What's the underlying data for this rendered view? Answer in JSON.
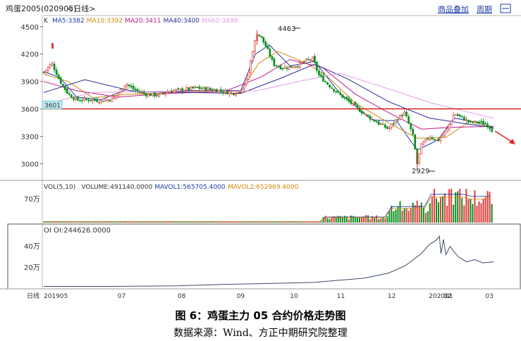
{
  "header": {
    "title": "鸡蛋2005(020905)",
    "period_label": "<日线>",
    "btn_overlay": "商品叠加",
    "btn_period": "周期"
  },
  "price_panel": {
    "type_label": "K",
    "ma_labels": [
      {
        "text": "MA5:3382",
        "color": "#1a3aa8"
      },
      {
        "text": "MA10:3392",
        "color": "#d4860b"
      },
      {
        "text": "MA20:3411",
        "color": "#c0188c"
      },
      {
        "text": "MA40:3400",
        "color": "#2a2a9a"
      },
      {
        "text": "MA60:3498",
        "color": "#e69be6"
      }
    ],
    "high_label": "4463",
    "low_label": "2929",
    "hline_label": "3601"
  },
  "volume_panel": {
    "labels": [
      {
        "text": "VOL(5,10)",
        "color": "#333333"
      },
      {
        "text": "VOLUME:491140.0000",
        "color": "#333333"
      },
      {
        "text": "MAVOL1:565705.4000",
        "color": "#1a3aa8"
      },
      {
        "text": "MAVOL2:652969.4000",
        "color": "#d4860b"
      }
    ]
  },
  "oi_panel": {
    "label": "OI OI:244626.0000"
  },
  "xaxis_prefix": "日线",
  "caption_title": "图 6：鸡蛋主力 05 合约价格走势图",
  "caption_source": "数据来源：Wind、方正中期研究院整理",
  "colors": {
    "up": "#e23b3b",
    "down": "#0a8f1e",
    "hline": "#d42020",
    "arrow": "#e02020",
    "oi_line": "#3a4a6a"
  },
  "chart_data": [
    {
      "type": "line",
      "name": "price",
      "ylim": [
        2850,
        4560
      ],
      "yticks": [
        "4500",
        "4200",
        "3900",
        "3600",
        "3300",
        "3000"
      ],
      "xticks": [
        "201905",
        "07",
        "08",
        "09",
        "10",
        "11",
        "12",
        "202001",
        "02",
        "03"
      ],
      "horizontal_line": 3601,
      "high": 4463,
      "low": 2929,
      "close_path": [
        [
          0,
          4000
        ],
        [
          10,
          4100
        ],
        [
          20,
          3900
        ],
        [
          30,
          3760
        ],
        [
          40,
          3700
        ],
        [
          55,
          3700
        ],
        [
          70,
          3690
        ],
        [
          85,
          3710
        ],
        [
          95,
          3820
        ],
        [
          100,
          3880
        ],
        [
          110,
          3810
        ],
        [
          125,
          3760
        ],
        [
          140,
          3750
        ],
        [
          155,
          3800
        ],
        [
          170,
          3810
        ],
        [
          185,
          3830
        ],
        [
          200,
          3820
        ],
        [
          215,
          3800
        ],
        [
          230,
          3770
        ],
        [
          240,
          3800
        ],
        [
          248,
          3930
        ],
        [
          255,
          4250
        ],
        [
          260,
          4430
        ],
        [
          265,
          4380
        ],
        [
          272,
          4260
        ],
        [
          280,
          4090
        ],
        [
          290,
          4050
        ],
        [
          300,
          4060
        ],
        [
          310,
          4080
        ],
        [
          320,
          4130
        ],
        [
          328,
          4150
        ],
        [
          335,
          3970
        ],
        [
          345,
          3880
        ],
        [
          360,
          3760
        ],
        [
          375,
          3660
        ],
        [
          390,
          3550
        ],
        [
          405,
          3460
        ],
        [
          420,
          3380
        ],
        [
          430,
          3490
        ],
        [
          440,
          3560
        ],
        [
          450,
          3300
        ],
        [
          455,
          3000
        ],
        [
          460,
          3200
        ],
        [
          470,
          3300
        ],
        [
          480,
          3250
        ],
        [
          490,
          3350
        ],
        [
          500,
          3550
        ],
        [
          510,
          3500
        ],
        [
          520,
          3450
        ],
        [
          530,
          3460
        ],
        [
          540,
          3430
        ],
        [
          548,
          3350
        ]
      ],
      "ma_series": [
        {
          "name": "MA5",
          "color": "#1a3aa8",
          "points": [
            [
              0,
              4010
            ],
            [
              20,
              3940
            ],
            [
              40,
              3730
            ],
            [
              70,
              3700
            ],
            [
              100,
              3810
            ],
            [
              130,
              3760
            ],
            [
              170,
              3800
            ],
            [
              210,
              3805
            ],
            [
              240,
              3800
            ],
            [
              258,
              4200
            ],
            [
              275,
              4300
            ],
            [
              300,
              4070
            ],
            [
              330,
              4120
            ],
            [
              360,
              3780
            ],
            [
              400,
              3480
            ],
            [
              430,
              3470
            ],
            [
              455,
              3150
            ],
            [
              480,
              3260
            ],
            [
              500,
              3500
            ],
            [
              530,
              3450
            ],
            [
              548,
              3382
            ]
          ]
        },
        {
          "name": "MA10",
          "color": "#d4860b",
          "points": [
            [
              0,
              3980
            ],
            [
              30,
              3900
            ],
            [
              60,
              3720
            ],
            [
              100,
              3760
            ],
            [
              140,
              3770
            ],
            [
              190,
              3800
            ],
            [
              240,
              3790
            ],
            [
              262,
              4100
            ],
            [
              285,
              4230
            ],
            [
              320,
              4100
            ],
            [
              345,
              3960
            ],
            [
              380,
              3660
            ],
            [
              420,
              3450
            ],
            [
              455,
              3280
            ],
            [
              490,
              3290
            ],
            [
              520,
              3470
            ],
            [
              548,
              3392
            ]
          ]
        },
        {
          "name": "MA20",
          "color": "#c0188c",
          "points": [
            [
              0,
              3900
            ],
            [
              40,
              3800
            ],
            [
              90,
              3730
            ],
            [
              150,
              3770
            ],
            [
              220,
              3790
            ],
            [
              265,
              3950
            ],
            [
              300,
              4140
            ],
            [
              340,
              4050
            ],
            [
              380,
              3760
            ],
            [
              420,
              3560
            ],
            [
              460,
              3380
            ],
            [
              500,
              3400
            ],
            [
              548,
              3411
            ]
          ]
        },
        {
          "name": "MA40",
          "color": "#2a2a9a",
          "points": [
            [
              0,
              3780
            ],
            [
              50,
              3920
            ],
            [
              110,
              3790
            ],
            [
              180,
              3780
            ],
            [
              240,
              3770
            ],
            [
              290,
              3940
            ],
            [
              330,
              4090
            ],
            [
              370,
              3930
            ],
            [
              420,
              3680
            ],
            [
              470,
              3500
            ],
            [
              520,
              3430
            ],
            [
              548,
              3400
            ]
          ]
        },
        {
          "name": "MA60",
          "color": "#e69be6",
          "points": [
            [
              0,
              3650
            ],
            [
              60,
              3780
            ],
            [
              130,
              3790
            ],
            [
              200,
              3790
            ],
            [
              260,
              3800
            ],
            [
              310,
              3900
            ],
            [
              360,
              3990
            ],
            [
              410,
              3850
            ],
            [
              470,
              3670
            ],
            [
              520,
              3560
            ],
            [
              548,
              3498
            ]
          ]
        }
      ]
    },
    {
      "type": "bar",
      "name": "volume",
      "unit_ticks": [
        "70万"
      ],
      "values_description_unit": "万手",
      "segments": [
        {
          "x_from": 0,
          "x_to": 340,
          "level": 1
        },
        {
          "x_from": 340,
          "x_to": 420,
          "level": 6
        },
        {
          "x_from": 420,
          "x_to": 470,
          "level": 17
        },
        {
          "x_from": 470,
          "x_to": 520,
          "level": 30
        },
        {
          "x_from": 520,
          "x_to": 548,
          "level": 28
        }
      ]
    },
    {
      "type": "line",
      "name": "open_interest",
      "ylim": [
        0,
        55
      ],
      "yticks": [
        "40万",
        "20万"
      ],
      "points": [
        [
          0,
          1
        ],
        [
          80,
          1
        ],
        [
          160,
          1.5
        ],
        [
          220,
          3
        ],
        [
          280,
          4
        ],
        [
          330,
          5
        ],
        [
          360,
          7
        ],
        [
          390,
          9
        ],
        [
          420,
          14
        ],
        [
          440,
          21
        ],
        [
          460,
          33
        ],
        [
          470,
          42
        ],
        [
          478,
          46
        ],
        [
          482,
          50
        ],
        [
          484,
          33
        ],
        [
          487,
          47
        ],
        [
          490,
          32
        ],
        [
          495,
          40
        ],
        [
          505,
          30
        ],
        [
          515,
          25
        ],
        [
          525,
          27
        ],
        [
          535,
          24
        ],
        [
          548,
          25
        ]
      ]
    }
  ]
}
